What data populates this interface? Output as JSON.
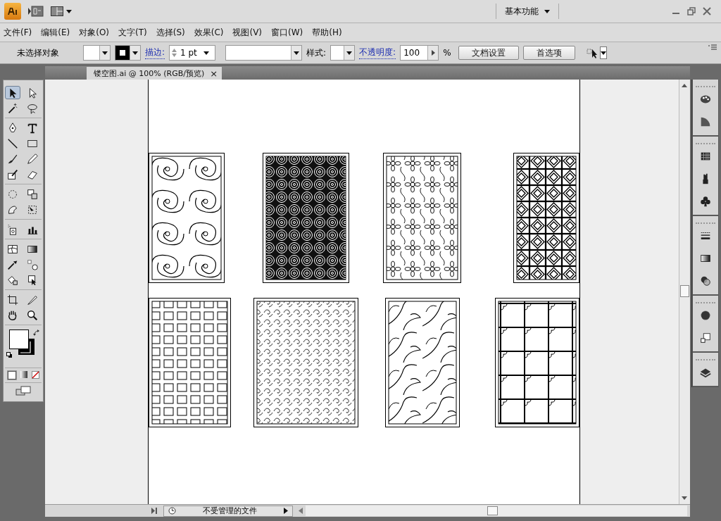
{
  "app_bar": {
    "workspace": "基本功能"
  },
  "menu": [
    "文件(F)",
    "编辑(E)",
    "对象(O)",
    "文字(T)",
    "选择(S)",
    "效果(C)",
    "视图(V)",
    "窗口(W)",
    "帮助(H)"
  ],
  "control_bar": {
    "selection_status": "未选择对象",
    "stroke_label": "描边:",
    "stroke_weight": "1 pt",
    "style_label": "样式:",
    "opacity_label": "不透明度:",
    "opacity": "100",
    "opacity_unit": "%",
    "buttons": [
      "文档设置",
      "首选项"
    ]
  },
  "document_tab": {
    "title": "镂空图.ai @ 100% (RGB/预览)",
    "close": "×"
  },
  "tool_groups": [
    {
      "tools": [
        {
          "kind": "selection",
          "selected": true
        },
        {
          "kind": "direct-selection",
          "selected": false
        },
        {
          "kind": "magic-wand",
          "selected": false
        },
        {
          "kind": "lasso",
          "selected": false
        }
      ]
    },
    {
      "tools": [
        {
          "kind": "pen",
          "selected": false
        },
        {
          "kind": "type",
          "selected": false
        },
        {
          "kind": "line",
          "selected": false
        },
        {
          "kind": "rectangle",
          "selected": false
        },
        {
          "kind": "brush",
          "selected": false
        },
        {
          "kind": "pencil",
          "selected": false
        },
        {
          "kind": "blob-brush",
          "selected": false
        },
        {
          "kind": "eraser",
          "selected": false
        }
      ]
    },
    {
      "tools": [
        {
          "kind": "rotate",
          "selected": false
        },
        {
          "kind": "scale",
          "selected": false
        },
        {
          "kind": "warp",
          "selected": false
        },
        {
          "kind": "free-transform",
          "selected": false
        }
      ]
    },
    {
      "tools": [
        {
          "kind": "sprayer",
          "selected": false
        },
        {
          "kind": "graph",
          "selected": false
        }
      ]
    },
    {
      "tools": [
        {
          "kind": "mesh",
          "selected": false
        },
        {
          "kind": "gradient",
          "selected": false
        },
        {
          "kind": "eyedropper",
          "selected": false
        },
        {
          "kind": "blend",
          "selected": false
        },
        {
          "kind": "bucket",
          "selected": false
        },
        {
          "kind": "select-arrow",
          "selected": false
        }
      ]
    },
    {
      "tools": [
        {
          "kind": "crop",
          "selected": false
        },
        {
          "kind": "knife",
          "selected": false
        },
        {
          "kind": "hand",
          "selected": false
        },
        {
          "kind": "zoom",
          "selected": false
        }
      ]
    }
  ],
  "dock_groups": [
    {
      "panels": [
        {
          "kind": "palette"
        },
        {
          "kind": "quarter-gradient"
        }
      ]
    },
    {
      "panels": [
        {
          "kind": "swatch-grid"
        },
        {
          "kind": "brushes"
        },
        {
          "kind": "club"
        }
      ]
    },
    {
      "panels": [
        {
          "kind": "stroke-lines"
        },
        {
          "kind": "gradient"
        },
        {
          "kind": "overlap-circles"
        }
      ]
    },
    {
      "panels": [
        {
          "kind": "ring"
        },
        {
          "kind": "two-squares"
        }
      ]
    },
    {
      "panels": [
        {
          "kind": "layers"
        }
      ]
    }
  ],
  "artwork": [
    {
      "kind": "scroll"
    },
    {
      "kind": "spiral"
    },
    {
      "kind": "floral"
    },
    {
      "kind": "star-lattice"
    },
    {
      "kind": "fret"
    },
    {
      "kind": "vine"
    },
    {
      "kind": "wave"
    },
    {
      "kind": "quatrefoil"
    }
  ],
  "status_bar": {
    "file_status": "不受管理的文件"
  }
}
